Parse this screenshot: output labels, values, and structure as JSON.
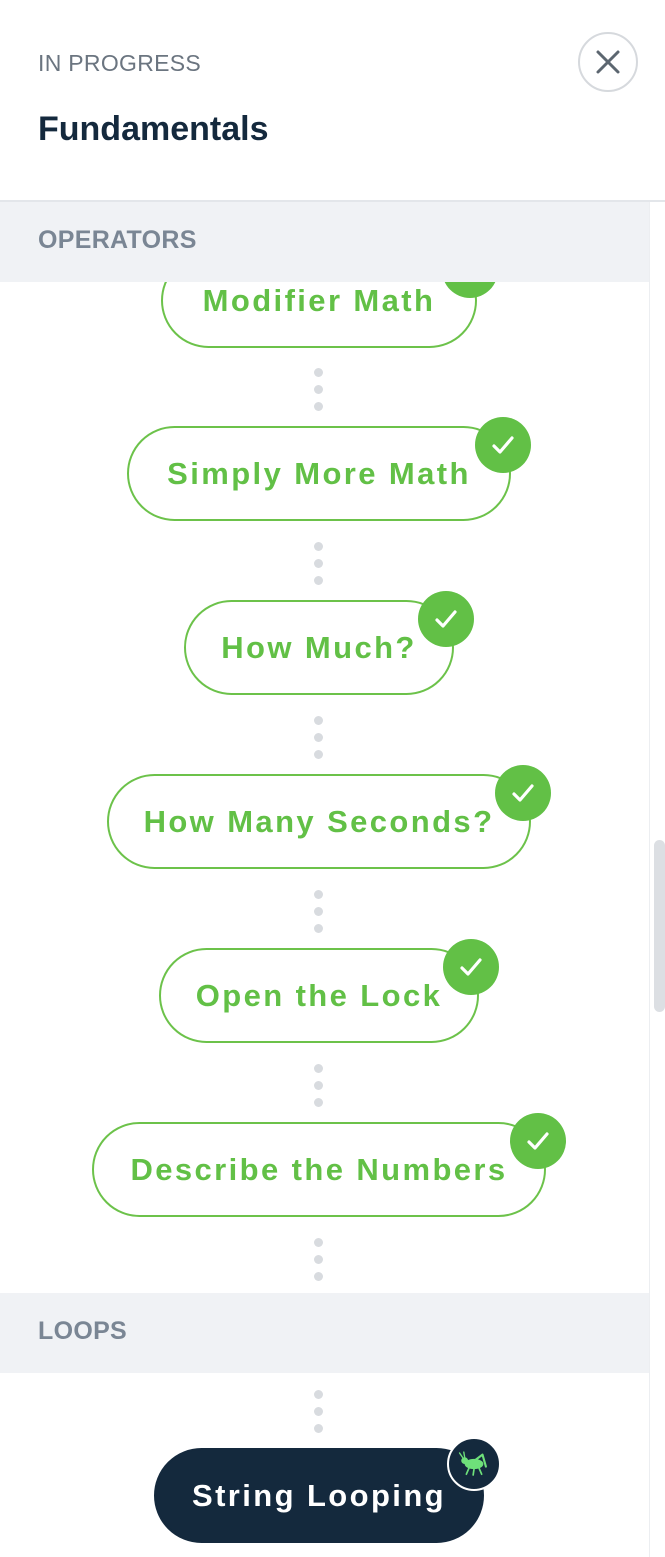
{
  "header": {
    "status": "IN PROGRESS",
    "title": "Fundamentals",
    "close_icon": "close-icon"
  },
  "sections": [
    {
      "name": "OPERATORS",
      "lessons": [
        {
          "label": "Modifier Math",
          "completed": true
        },
        {
          "label": "Simply More Math",
          "completed": true
        },
        {
          "label": "How Much?",
          "completed": true
        },
        {
          "label": "How Many Seconds?",
          "completed": true
        },
        {
          "label": "Open the Lock",
          "completed": true
        },
        {
          "label": "Describe the Numbers",
          "completed": true
        }
      ]
    },
    {
      "name": "LOOPS",
      "lessons": [
        {
          "label": "String Looping",
          "completed": false,
          "current": true,
          "icon": "grasshopper-icon"
        }
      ]
    }
  ],
  "colors": {
    "accent_green": "#62c046",
    "dark_navy": "#14293d",
    "section_bg": "#f0f2f5"
  }
}
